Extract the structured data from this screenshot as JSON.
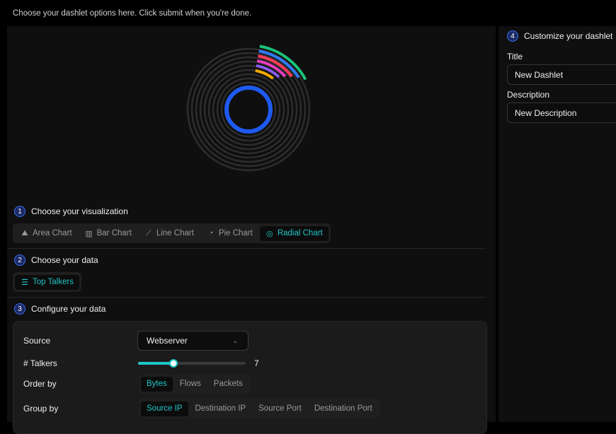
{
  "instruction": "Choose your dashlet options here. Click submit when you're done.",
  "preview": {
    "rings": 9,
    "center_ring_color": "#1f5af0",
    "arc_colors": [
      "#f2a900",
      "#8a5cf0",
      "#e83fc0",
      "#ff3b5c",
      "#2f7bf5",
      "#1dc27a"
    ]
  },
  "steps": {
    "s1": {
      "num": "1",
      "title": "Choose your visualization"
    },
    "s2": {
      "num": "2",
      "title": "Choose your data"
    },
    "s3": {
      "num": "3",
      "title": "Configure your data"
    },
    "s4": {
      "num": "4",
      "title": "Customize your dashlet"
    }
  },
  "viz_options": [
    {
      "label": "Area Chart",
      "icon": "area-chart-icon",
      "glyph": "⛰"
    },
    {
      "label": "Bar Chart",
      "icon": "bar-chart-icon",
      "glyph": "▥"
    },
    {
      "label": "Line Chart",
      "icon": "line-chart-icon",
      "glyph": "⟋"
    },
    {
      "label": "Pie Chart",
      "icon": "pie-chart-icon",
      "glyph": "◔"
    },
    {
      "label": "Radial Chart",
      "icon": "radial-chart-icon",
      "glyph": "◎",
      "active": true
    }
  ],
  "data_option": {
    "label": "Top Talkers",
    "icon": "list-icon",
    "glyph": "☰"
  },
  "config": {
    "source_label": "Source",
    "source_value": "Webserver",
    "talkers_label": "# Talkers",
    "talkers_value": "7",
    "talkers_fraction": 0.33,
    "order_label": "Order by",
    "order_options": [
      "Bytes",
      "Flows",
      "Packets"
    ],
    "order_active": 0,
    "group_label": "Group by",
    "group_options": [
      "Source IP",
      "Destination IP",
      "Source Port",
      "Destination Port"
    ],
    "group_active": 0
  },
  "customize": {
    "title_label": "Title",
    "title_value": "New Dashlet",
    "desc_label": "Description",
    "desc_value": "New Description"
  },
  "colors": {
    "accent": "#1fc6c6",
    "step_badge": "#3d6df0"
  }
}
